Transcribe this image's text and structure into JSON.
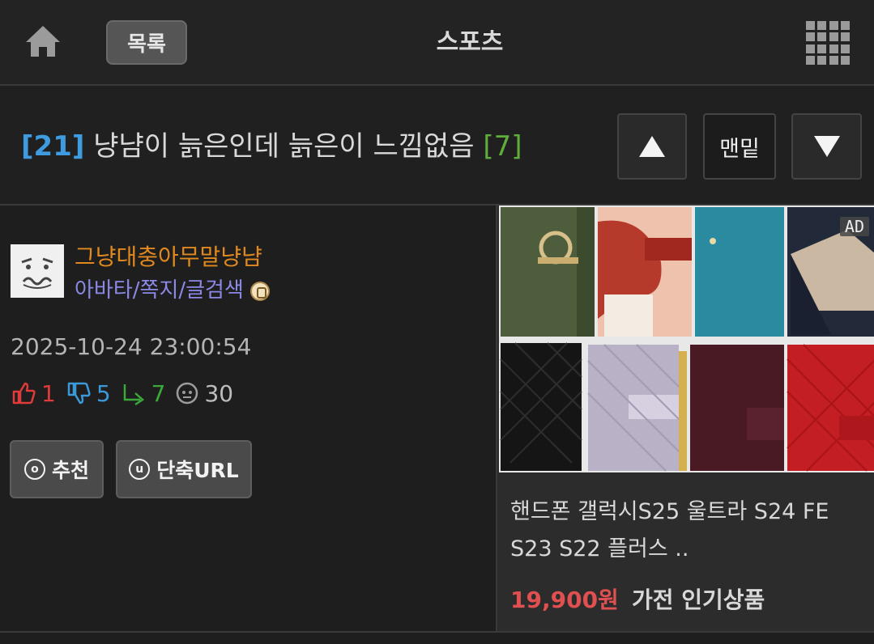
{
  "topbar": {
    "list_label": "목록",
    "board_title": "스포츠"
  },
  "post": {
    "number": "[21]",
    "title": "냥냠이 늙은인데 늙은이 느낌없음",
    "comment_count": "[7]"
  },
  "nav": {
    "bottom_label": "맨밑"
  },
  "author": {
    "nickname": "그냥대충아무말냥냠",
    "links": "아바타/쪽지/글검색"
  },
  "meta": {
    "date": "2025-10-24 23:00:54",
    "upvotes": "1",
    "downvotes": "5",
    "replies": "7",
    "views": "30"
  },
  "actions": {
    "recommend_label": "추천",
    "short_url_label": "단축URL"
  },
  "ad": {
    "badge": "AD",
    "product_name": "핸드폰 갤럭시S25 울트라 S24 FE S23 S22 플러스 ..",
    "price": "19,900원",
    "category": "가전 인기상품"
  },
  "colors": {
    "post_number": "#3f9be0",
    "comment_count": "#5fae3c",
    "nickname": "#e0891e",
    "links": "#8c89e6",
    "price": "#e05050"
  }
}
